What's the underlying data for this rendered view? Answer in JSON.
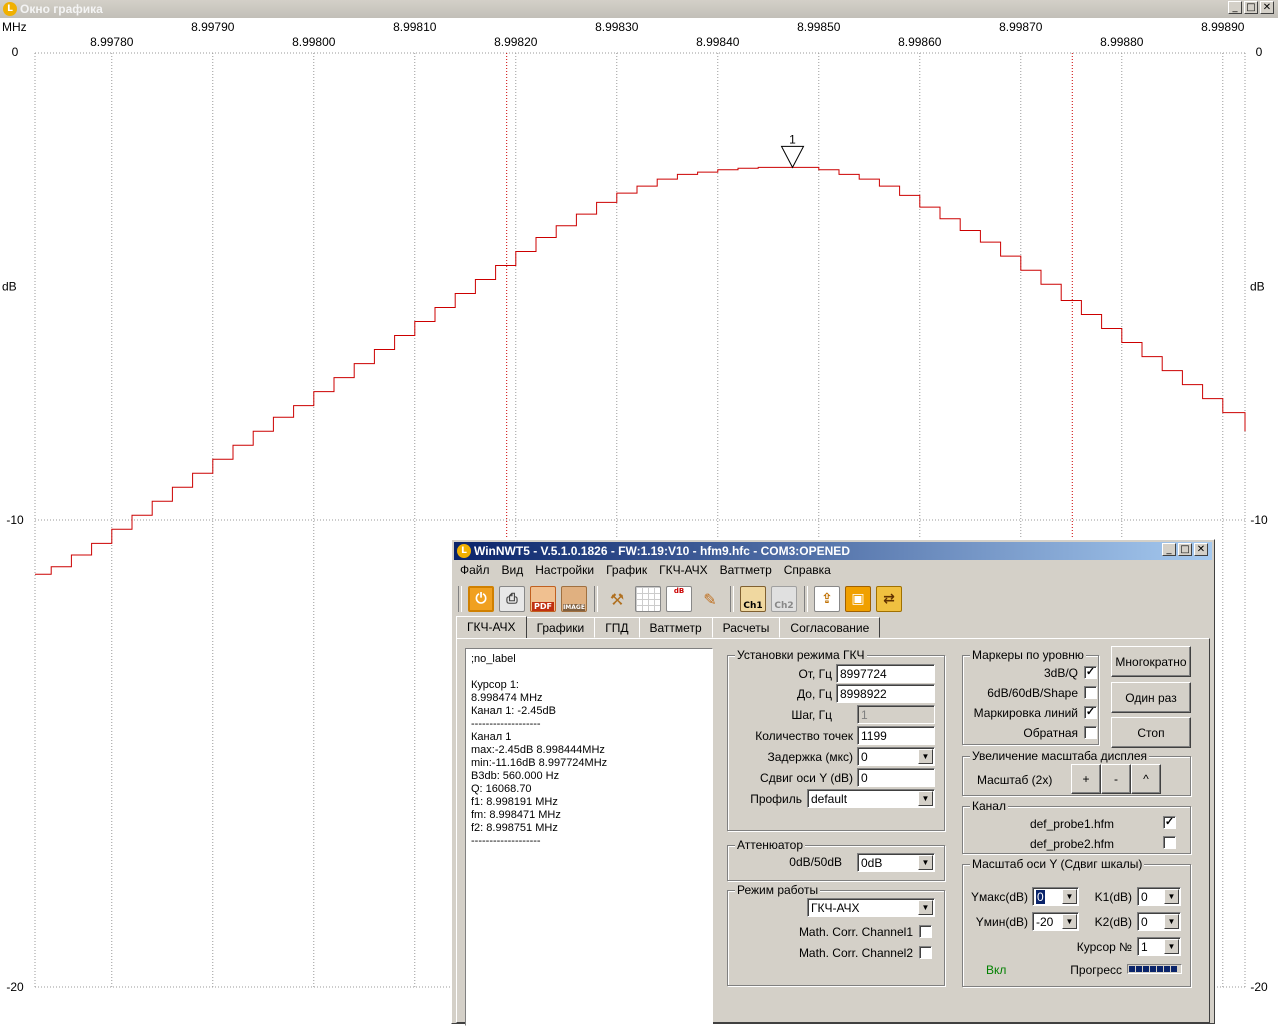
{
  "graph_window": {
    "title": "Окно графика",
    "controls": {
      "minimize": "_",
      "maximize": "□",
      "close": "✕"
    }
  },
  "chart_data": {
    "type": "line",
    "x_unit_label": "MHz",
    "y_unit_label": "dB",
    "xlim": [
      8.997724,
      8.998922
    ],
    "ylim": [
      -20,
      0
    ],
    "x_ticks_top": [
      "8.99790",
      "8.99810",
      "8.99830",
      "8.99850",
      "8.99870",
      "8.99890"
    ],
    "x_ticks_bottom": [
      "8.99780",
      "8.99800",
      "8.99820",
      "8.99840",
      "8.99860",
      "8.99880"
    ],
    "y_ticks_left": [
      "0",
      "-10",
      "-20"
    ],
    "y_ticks_right": [
      "0",
      "-10",
      "-20"
    ],
    "grid": true,
    "marker": {
      "label": "1",
      "x": 8.998474,
      "y": -2.45
    },
    "bandwidth_lines_x": [
      8.998191,
      8.998751
    ],
    "series": [
      {
        "color": "#cc0000",
        "x": [
          8.997724,
          8.99774,
          8.99776,
          8.99778,
          8.9978,
          8.99782,
          8.99784,
          8.99786,
          8.99788,
          8.9979,
          8.99792,
          8.99794,
          8.99796,
          8.99798,
          8.998,
          8.99802,
          8.99804,
          8.99806,
          8.99808,
          8.9981,
          8.99812,
          8.99814,
          8.99816,
          8.99818,
          8.9982,
          8.99822,
          8.99824,
          8.99826,
          8.99828,
          8.9983,
          8.99832,
          8.99834,
          8.99836,
          8.99838,
          8.9984,
          8.99842,
          8.99844,
          8.99846,
          8.99848,
          8.9985,
          8.99852,
          8.99854,
          8.99856,
          8.99858,
          8.9986,
          8.99862,
          8.99864,
          8.99866,
          8.99868,
          8.9987,
          8.99872,
          8.99874,
          8.99876,
          8.99878,
          8.9988,
          8.99882,
          8.99884,
          8.99886,
          8.99888,
          8.9989,
          8.998922
        ],
        "y": [
          -11.16,
          -11.0,
          -10.75,
          -10.5,
          -10.2,
          -9.9,
          -9.6,
          -9.3,
          -9.0,
          -8.7,
          -8.4,
          -8.1,
          -7.8,
          -7.55,
          -7.25,
          -6.95,
          -6.65,
          -6.35,
          -6.05,
          -5.75,
          -5.45,
          -5.15,
          -4.85,
          -4.55,
          -4.25,
          -3.95,
          -3.7,
          -3.45,
          -3.2,
          -3.0,
          -2.85,
          -2.7,
          -2.6,
          -2.55,
          -2.5,
          -2.47,
          -2.45,
          -2.45,
          -2.45,
          -2.5,
          -2.6,
          -2.7,
          -2.85,
          -3.05,
          -3.3,
          -3.55,
          -3.8,
          -4.05,
          -4.35,
          -4.65,
          -4.95,
          -5.3,
          -5.6,
          -5.9,
          -6.2,
          -6.5,
          -6.8,
          -7.1,
          -7.4,
          -7.7,
          -8.1
        ]
      }
    ]
  },
  "dialog": {
    "title": "WinNWT5 - V.5.1.0.1826 - FW:1.19:V10 - hfm9.hfc - COM3:OPENED",
    "menu": [
      "Файл",
      "Вид",
      "Настройки",
      "График",
      "ГКЧ-АЧХ",
      "Ваттметр",
      "Справка"
    ],
    "toolbar_icons": [
      "power-icon",
      "print-icon",
      "pdf-icon",
      "image-icon",
      "tools-icon",
      "grid-icon",
      "db-graph-icon",
      "wrench-icon",
      "ch1-icon",
      "ch2-icon",
      "export-icon",
      "save-icon",
      "swap-icon"
    ],
    "toolbar_text": {
      "pdf": "PDF",
      "image": "IMAGE",
      "db": "dB",
      "ch1": "Ch1",
      "ch2": "Ch2"
    },
    "tabs": [
      "ГКЧ-АЧХ",
      "Графики",
      "ГПД",
      "Ваттметр",
      "Расчеты",
      "Согласование"
    ],
    "active_tab": "ГКЧ-АЧХ",
    "info_lines": [
      ";no_label",
      "",
      "Курсор 1:",
      "8.998474 MHz",
      "Канал 1:  -2.45dB",
      "-------------------",
      "Канал 1",
      "max:-2.45dB 8.998444MHz",
      "min:-11.16dB 8.997724MHz",
      "B3db: 560.000 Hz",
      "Q: 16068.70",
      "f1: 8.998191 MHz",
      "fm: 8.998471 MHz",
      "f2: 8.998751 MHz",
      "-------------------"
    ],
    "sweep": {
      "legend": "Установки режима ГКЧ",
      "from_label": "От, Гц",
      "from_value": "8997724",
      "to_label": "До, Гц",
      "to_value": "8998922",
      "step_label": "Шаг, Гц",
      "step_value": "1",
      "points_label": "Количество точек",
      "points_value": "1199",
      "delay_label": "Задержка (мкс)",
      "delay_value": "0",
      "yshift_label": "Сдвиг оси Y (dB)",
      "yshift_value": "0",
      "profile_label": "Профиль",
      "profile_value": "default"
    },
    "attenuator": {
      "legend": "Аттенюатор",
      "label": "0dB/50dB",
      "value": "0dB"
    },
    "mode": {
      "legend": "Режим работы",
      "value": "ГКЧ-АЧХ",
      "corr1_label": "Math. Corr. Channel1",
      "corr1_checked": false,
      "corr2_label": "Math. Corr. Channel2",
      "corr2_checked": false
    },
    "level_markers": {
      "legend": "Маркеры по уровню",
      "q3db_label": "3dB/Q",
      "q3db_checked": true,
      "shape_label": "6dB/60dB/Shape",
      "shape_checked": false,
      "linemark_label": "Маркировка линий",
      "linemark_checked": true,
      "reverse_label": "Обратная",
      "reverse_checked": false
    },
    "run_buttons": {
      "multi": "Многократно",
      "once": "Один раз",
      "stop": "Стоп"
    },
    "zoom": {
      "legend": "Увеличение масштаба дисплея",
      "label": "Масштаб (2x)",
      "plus": "+",
      "minus": "-",
      "up": "^"
    },
    "channel": {
      "legend": "Канал",
      "probe1": "def_probe1.hfm",
      "probe1_checked": true,
      "probe2": "def_probe2.hfm",
      "probe2_checked": false
    },
    "yscale": {
      "legend": "Масштаб оси Y (Сдвиг шкалы)",
      "ymax_label": "Yмакс(dB)",
      "ymax_value": "0",
      "k1_label": "K1(dB)",
      "k1_value": "0",
      "ymin_label": "Yмин(dB)",
      "ymin_value": "-20",
      "k2_label": "K2(dB)",
      "k2_value": "0",
      "cursor_label": "Курсор №",
      "cursor_value": "1",
      "on_label": "Вкл",
      "progress_label": "Прогресс"
    },
    "colors": {
      "on_label": "#008000",
      "title_gradient_start": "#0a246a",
      "trace": "#cc0000"
    }
  }
}
